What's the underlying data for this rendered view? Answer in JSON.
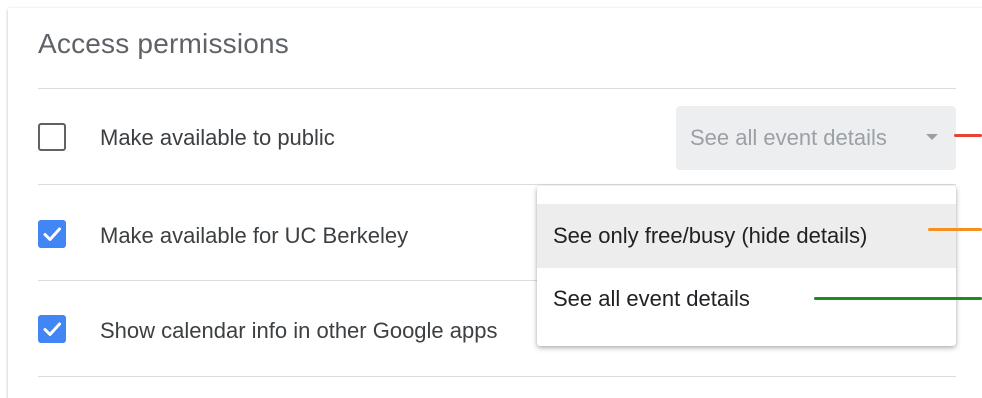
{
  "panel": {
    "title": "Access permissions"
  },
  "rows": [
    {
      "label": "Make available to public",
      "checked": false
    },
    {
      "label": "Make available for UC Berkeley",
      "checked": true
    },
    {
      "label": "Show calendar info in other Google apps",
      "checked": true
    }
  ],
  "access_select": {
    "selected_value": "See all event details",
    "options": [
      "See only free/busy (hide details)",
      "See all event details"
    ],
    "highlighted_option": "See only free/busy (hide details)"
  },
  "colors": {
    "checkbox_checked": "#4285f4",
    "annotation_red": "#e84235",
    "annotation_orange": "#f5901e",
    "annotation_green": "#1e8c1e"
  },
  "icons": {
    "checkmark": "check-icon",
    "dropdown_caret": "caret-down-icon"
  }
}
